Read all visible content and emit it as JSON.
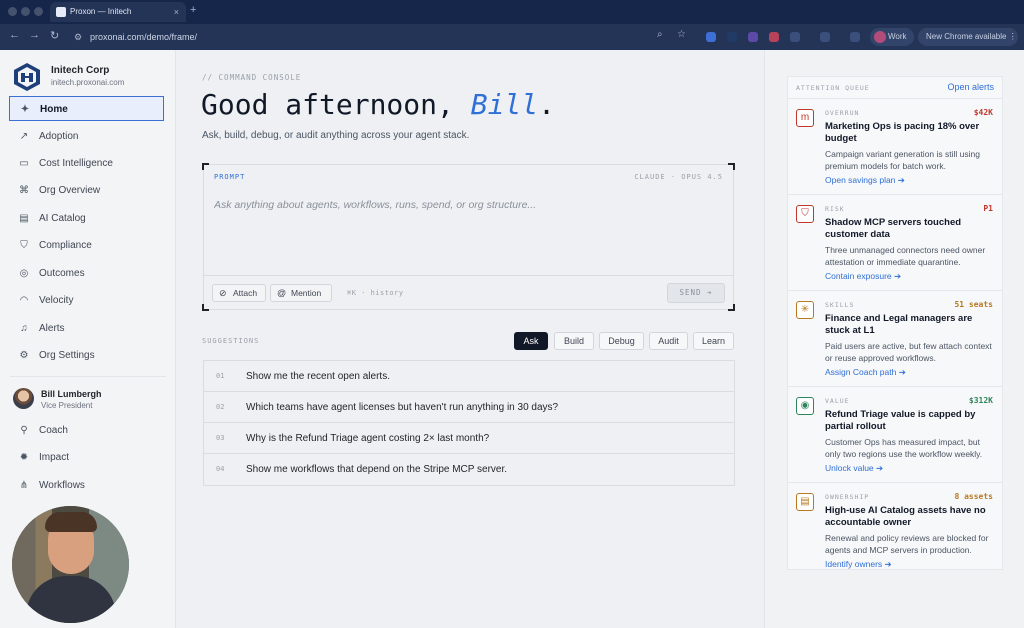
{
  "browser": {
    "tab_title": "Proxon — Initech",
    "tab_close": "×",
    "new_tab": "+",
    "url": "proxonai.com/demo/frame/",
    "profile_label": "Work",
    "update_label": "New Chrome available  ⋮"
  },
  "org": {
    "name": "Initech Corp",
    "domain": "initech.proxonai.com"
  },
  "sidebar": {
    "items": [
      {
        "label": "Home",
        "icon": "sparkle-icon"
      },
      {
        "label": "Adoption",
        "icon": "trend-icon"
      },
      {
        "label": "Cost Intelligence",
        "icon": "money-icon"
      },
      {
        "label": "Org Overview",
        "icon": "org-icon"
      },
      {
        "label": "AI Catalog",
        "icon": "catalog-icon"
      },
      {
        "label": "Compliance",
        "icon": "shield-icon"
      },
      {
        "label": "Outcomes",
        "icon": "target-icon"
      },
      {
        "label": "Velocity",
        "icon": "gauge-icon"
      },
      {
        "label": "Alerts",
        "icon": "bell-icon"
      },
      {
        "label": "Org Settings",
        "icon": "gear-icon"
      }
    ],
    "user": {
      "name": "Bill Lumbergh",
      "role": "Vice President"
    },
    "lower_items": [
      {
        "label": "Coach",
        "icon": "person-icon"
      },
      {
        "label": "Impact",
        "icon": "impact-icon"
      },
      {
        "label": "Workflows",
        "icon": "workflow-icon"
      }
    ]
  },
  "main": {
    "eyebrow": "// COMMAND CONSOLE",
    "greeting_prefix": "Good afternoon, ",
    "greeting_name": "Bill",
    "greeting_suffix": ".",
    "subtitle": "Ask, build, debug, or audit anything across your agent stack.",
    "prompt_label": "PROMPT",
    "model_label": "CLAUDE · OPUS 4.5",
    "prompt_placeholder": "Ask anything about agents, workflows, runs, spend, or org structure...",
    "attach_label": "Attach",
    "mention_label": "Mention",
    "history_hint": "⌘K · history",
    "send_label": "SEND ➔",
    "suggestions_label": "SUGGESTIONS",
    "chips": [
      "Ask",
      "Build",
      "Debug",
      "Audit",
      "Learn"
    ],
    "active_chip": "Ask",
    "suggestions": [
      {
        "num": "01",
        "text": "Show me the recent open alerts."
      },
      {
        "num": "02",
        "text": "Which teams have agent licenses but haven't run anything in 30 days?"
      },
      {
        "num": "03",
        "text": "Why is the Refund Triage agent costing 2× last month?"
      },
      {
        "num": "04",
        "text": "Show me workflows that depend on the Stripe MCP server."
      }
    ]
  },
  "queue": {
    "title": "ATTENTION QUEUE",
    "link": "Open alerts",
    "items": [
      {
        "tag": "OVERRUN",
        "value": "$42K",
        "title": "Marketing Ops is pacing 18% over budget",
        "desc": "Campaign variant generation is still using premium models for batch work.",
        "action": "Open savings plan ➔",
        "color": "#c0392b",
        "icon": "overrun-icon",
        "glyph": "m"
      },
      {
        "tag": "RISK",
        "value": "P1",
        "title": "Shadow MCP servers touched customer data",
        "desc": "Three unmanaged connectors need owner attestation or immediate quarantine.",
        "action": "Contain exposure ➔",
        "color": "#c0392b",
        "icon": "shield-icon",
        "glyph": "⛉"
      },
      {
        "tag": "SKILLS",
        "value": "51 seats",
        "title": "Finance and Legal managers are stuck at L1",
        "desc": "Paid users are active, but few attach context or reuse approved workflows.",
        "action": "Assign Coach path ➔",
        "color": "#b7791f",
        "icon": "skills-icon",
        "glyph": "✳"
      },
      {
        "tag": "VALUE",
        "value": "$312K",
        "title": "Refund Triage value is capped by partial rollout",
        "desc": "Customer Ops has measured impact, but only two regions use the workflow weekly.",
        "action": "Unlock value ➔",
        "color": "#2f855a",
        "icon": "value-icon",
        "glyph": "◉"
      },
      {
        "tag": "OWNERSHIP",
        "value": "8 assets",
        "title": "High-use AI Catalog assets have no accountable owner",
        "desc": "Renewal and policy reviews are blocked for agents and MCP servers in production.",
        "action": "Identify owners ➔",
        "color": "#b7791f",
        "icon": "ownership-icon",
        "glyph": "▤"
      }
    ]
  }
}
